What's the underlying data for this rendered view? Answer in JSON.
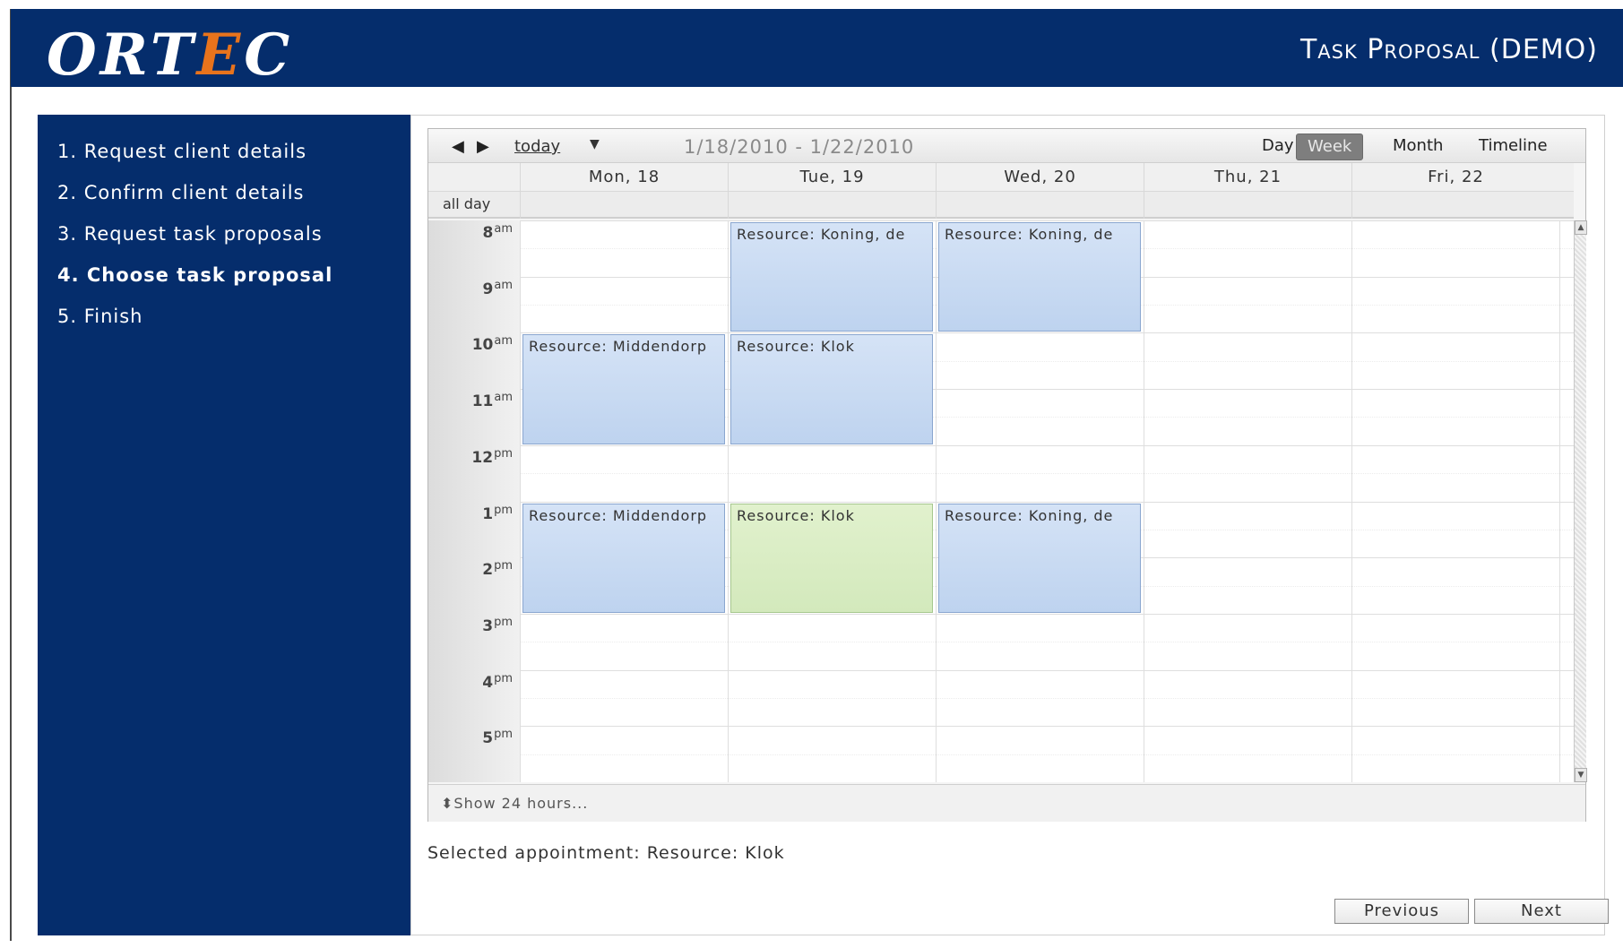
{
  "header": {
    "logo_pre": "ORT",
    "logo_accent": "E",
    "logo_post": "C",
    "title": "Task Proposal (DEMO)"
  },
  "sidebar": {
    "steps": [
      {
        "label": "1. Request client details"
      },
      {
        "label": "2. Confirm client details"
      },
      {
        "label": "3. Request task proposals"
      },
      {
        "label": "4. Choose task proposal"
      },
      {
        "label": "5. Finish"
      }
    ],
    "active_step": 4
  },
  "calendar": {
    "today_label": "today",
    "date_range": "1/18/2010 - 1/22/2010",
    "views": [
      "Day",
      "Week",
      "Month",
      "Timeline"
    ],
    "active_view": "Week",
    "days": [
      "Mon, 18",
      "Tue, 19",
      "Wed, 20",
      "Thu, 21",
      "Fri, 22"
    ],
    "all_day_label": "all day",
    "hours": [
      {
        "num": "8",
        "ampm": "am"
      },
      {
        "num": "9",
        "ampm": "am"
      },
      {
        "num": "10",
        "ampm": "am"
      },
      {
        "num": "11",
        "ampm": "am"
      },
      {
        "num": "12",
        "ampm": "pm"
      },
      {
        "num": "1",
        "ampm": "pm"
      },
      {
        "num": "2",
        "ampm": "pm"
      },
      {
        "num": "3",
        "ampm": "pm"
      },
      {
        "num": "4",
        "ampm": "pm"
      },
      {
        "num": "5",
        "ampm": "pm"
      }
    ],
    "appointments": [
      {
        "title": "Resource: Koning, de",
        "day": 1,
        "start": 8,
        "end": 10,
        "color": "blue"
      },
      {
        "title": "Resource: Koning, de",
        "day": 2,
        "start": 8,
        "end": 10,
        "color": "blue"
      },
      {
        "title": "Resource: Middendorp",
        "day": 0,
        "start": 10,
        "end": 12,
        "color": "blue"
      },
      {
        "title": "Resource: Klok",
        "day": 1,
        "start": 10,
        "end": 12,
        "color": "blue"
      },
      {
        "title": "Resource: Middendorp",
        "day": 0,
        "start": 13,
        "end": 15,
        "color": "blue"
      },
      {
        "title": "Resource: Klok",
        "day": 1,
        "start": 13,
        "end": 15,
        "color": "green"
      },
      {
        "title": "Resource: Koning, de",
        "day": 2,
        "start": 13,
        "end": 15,
        "color": "blue"
      }
    ],
    "show_24_label": "Show 24 hours..."
  },
  "selection": {
    "text": "Selected appointment: Resource: Klok"
  },
  "buttons": {
    "previous": "Previous",
    "next": "Next"
  },
  "colors": {
    "header_bg": "#052d6c",
    "sidebar_bg": "#052d6c",
    "logo_accent": "#e8731c",
    "appt_blue": "#c4d7f1",
    "appt_green": "#d8ecc2",
    "active_view_bg": "#7e7e7e"
  }
}
